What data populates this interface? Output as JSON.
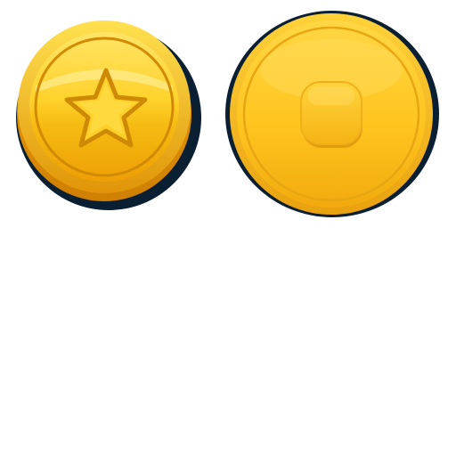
{
  "scene": {
    "background": "#ffffff"
  },
  "coins": [
    {
      "id": "coin-star",
      "emblem": "star-icon",
      "colors": {
        "shadow": "#0b1f33",
        "rim_outer": "#f2b90c",
        "rim_dark": "#d98f05",
        "face_light": "#ffe466",
        "face_mid": "#ffcf26",
        "face_dark": "#f0a808",
        "ring": "#d18a04",
        "emblem_fill": "#ffd02a",
        "emblem_stroke": "#cf8a05"
      }
    },
    {
      "id": "coin-square",
      "emblem": "rounded-square-icon",
      "colors": {
        "shadow": "#0b1f33",
        "rim_outer": "#f4be22",
        "rim_dark": "#e39e0c",
        "face_light": "#ffd744",
        "face_mid": "#ffc81f",
        "face_dark": "#f2ab0e",
        "ring": "#e7a612",
        "emblem_fill": "#ffc625",
        "emblem_stroke": "#e7a010"
      }
    }
  ]
}
